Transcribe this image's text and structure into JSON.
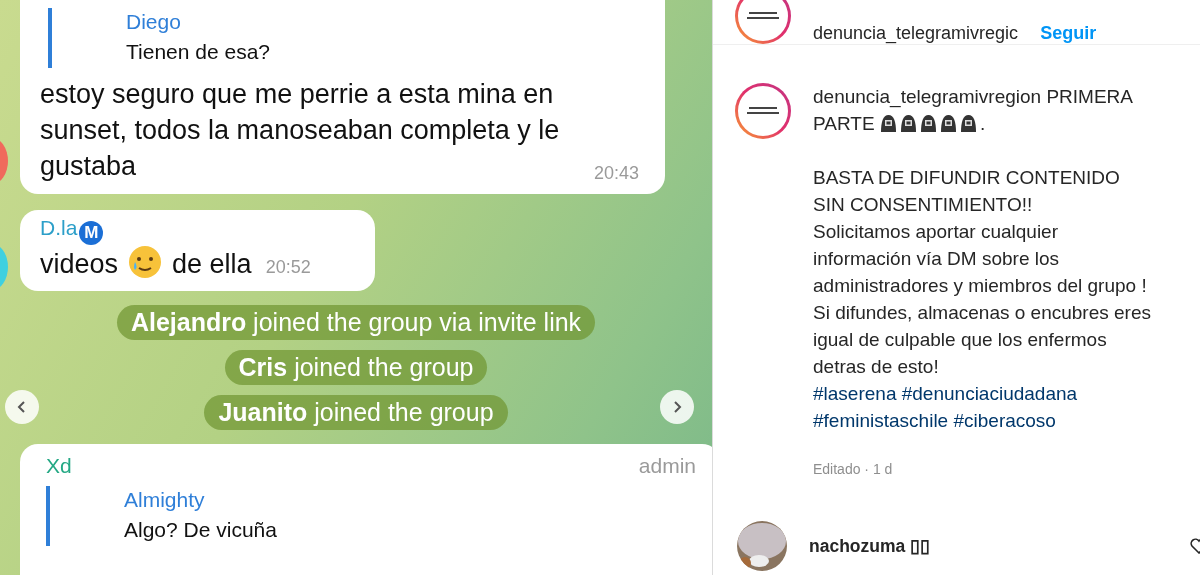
{
  "chat": {
    "messages": [
      {
        "kind": "reply",
        "reply_author": "Diego",
        "reply_text": "Tienen de esa?",
        "text": "estoy seguro que me perrie a esta mina en sunset, todos la manoseaban completa y le gustaba",
        "time": "20:43"
      },
      {
        "kind": "emoji",
        "author": "D.la",
        "badge": "M",
        "text_before": "videos",
        "text_after": "de ella",
        "time": "20:52"
      },
      {
        "kind": "service",
        "text": "**Alejandro** joined the group via invite link"
      },
      {
        "kind": "service",
        "text": "**Cris** joined the group"
      },
      {
        "kind": "service",
        "text": "**Juanito** joined the group"
      },
      {
        "kind": "admin",
        "author": "Xd",
        "role": "admin",
        "reply_author": "Almighty",
        "reply_text": "Algo? De vicuña"
      }
    ]
  },
  "post": {
    "header": {
      "username": "denuncia_telegramivregic",
      "follow": "Seguir"
    },
    "caption": {
      "username": "denuncia_telegramivregion",
      "title_words": [
        "PRIMERA",
        "PARTE"
      ],
      "title_end": ".",
      "paragraphs": [
        "BASTA DE DIFUNDIR CONTENIDO SIN CONSENTIMIENTO!!",
        "Solicitamos aportar cualquier información vía DM sobre los administradores y miembros del grupo !",
        "Si difundes, almacenas o encubres eres igual de culpable que los enfermos detras de esto!"
      ],
      "hashtags": [
        "#laserena",
        "#denunciaciudadana",
        "#feministaschile",
        "#ciberacoso"
      ],
      "meta": "Editado · 1 d"
    },
    "comments": [
      {
        "username": "nachozuma",
        "suffix": "▯▯"
      }
    ]
  }
}
